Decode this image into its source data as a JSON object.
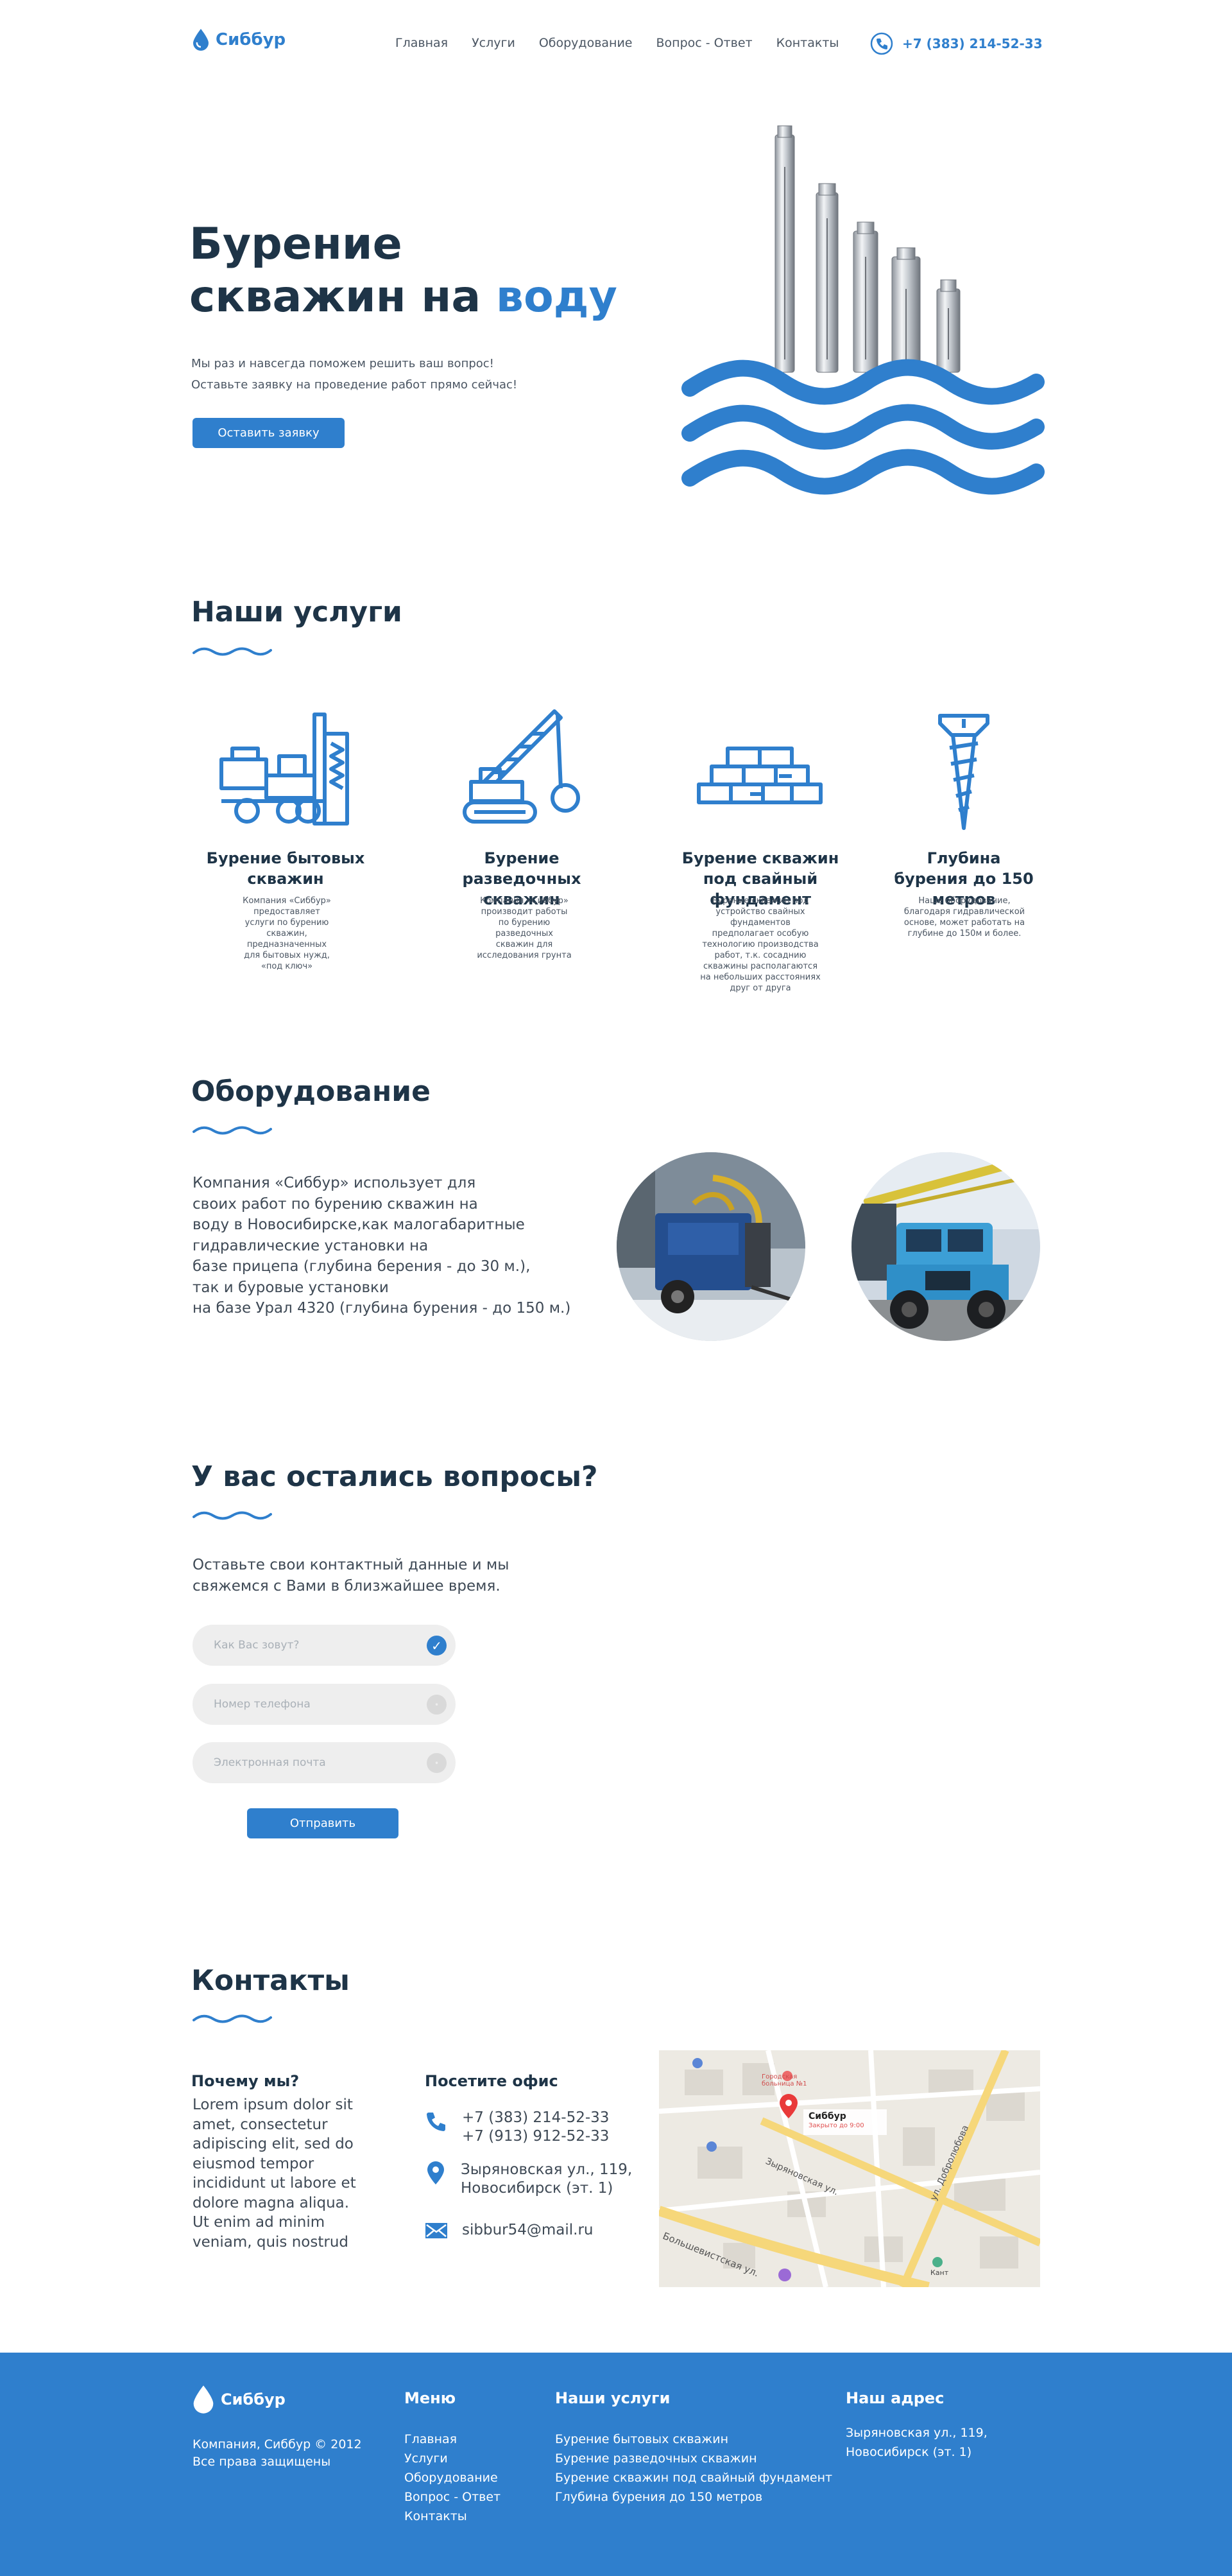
{
  "brand": {
    "name": "Сиббур",
    "color": "#2f7fcd"
  },
  "header": {
    "nav": [
      "Главная",
      "Услуги",
      "Оборудование",
      "Вопрос - Ответ",
      "Контакты"
    ],
    "phone": "+7 (383) 214-52-33",
    "phone_icon": "phone-icon"
  },
  "hero": {
    "title_line1": "Бурение",
    "title_line2_prefix": "скважин на ",
    "title_line2_accent": "воду",
    "subtitle_line1": "Мы раз и навсегда поможем решить ваш вопрос!",
    "subtitle_line2": "Оставьте заявку на проведение работ прямо сейчас!",
    "button": "Оставить заявку"
  },
  "services": {
    "title": "Наши услуги",
    "items": [
      {
        "icon": "drilling-rig-icon",
        "title": "Бурение бытовых скважин",
        "desc": "Компания «Сиббур» предоставляет услуги по бурению скважин, предназначенных для бытовых нужд, «под ключ»"
      },
      {
        "icon": "crane-icon",
        "title": "Бурение разведочных скважин",
        "desc": "Компания «Сиббур» производит работы по бурению разведочных скважин для исследования грунта"
      },
      {
        "icon": "bricks-icon",
        "title": "Бурение скважин под свайный фундамент",
        "desc": "Бурение скважин под устройство свайных фундаментов предполагает особую технологию производства работ, т.к. сосаднию скважины располагаются на небольших расстояниях друг от друга"
      },
      {
        "icon": "screw-icon",
        "title": "Глубина бурения до 150 метров",
        "desc": "Наше оборудование, благодаря гидравлической основе, может работать на глубине до 150м и более."
      }
    ]
  },
  "equipment": {
    "title": "Оборудование",
    "lines": [
      "Компания «Сиббур» использует для",
      "своих работ по бурению скважин на",
      "воду в Новосибирске,как малогабаритные",
      "гидравлические установки на",
      "базе прицепа (глубина берения - до 30 м.),",
      "так и буровые установки",
      "на базе Урал 4320 (глубина бурения - до 150 м.)"
    ]
  },
  "questions": {
    "title": "У вас остались вопросы?",
    "subtitle_line1": "Оставьте свои контактный данные и мы",
    "subtitle_line2": "свяжемся с Вами в близжайшее время.",
    "fields": [
      {
        "placeholder": "Как Вас зовут?",
        "checked": true
      },
      {
        "placeholder": "Номер телефона",
        "checked": false
      },
      {
        "placeholder": "Электронная почта",
        "checked": false
      }
    ],
    "button": "Отправить"
  },
  "contacts": {
    "title": "Контакты",
    "why_title": "Почему мы?",
    "why_text": "Lorem ipsum dolor sit amet, consectetur adipiscing elit, sed do eiusmod tempor incididunt ut labore et dolore magna aliqua. Ut enim ad minim veniam, quis nostrud",
    "visit_title": "Посетите офис",
    "phone1": "+7 (383) 214-52-33",
    "phone2": "+7 (913) 912-52-33",
    "address_line1": "Зыряновская ул., 119,",
    "address_line2": "Новосибирск (эт. 1)",
    "email": "sibbur54@mail.ru",
    "map": {
      "marker_title": "Сиббур",
      "marker_sub": "Закрыто до 9:00",
      "street1": "Большевистская ул.",
      "street2": "Зыряновская ул.",
      "street3": "ул. Добролюбова",
      "poi1": "Городская больница №1",
      "poi2": "Кант"
    }
  },
  "footer": {
    "copyright1": "Компания, Сиббур © 2012",
    "copyright2": "Все права защищены",
    "menu_title": "Меню",
    "menu": [
      "Главная",
      "Услуги",
      "Оборудование",
      "Вопрос - Ответ",
      "Контакты"
    ],
    "services_title": "Наши услуги",
    "services": [
      "Бурение бытовых скважин",
      "Бурение разведочных скважин",
      "Бурение скважин под свайный фундамент",
      "Глубина бурения до 150 метров"
    ],
    "address_title": "Наш адрес",
    "address_line1": "Зыряновская ул., 119,",
    "address_line2": "Новосибирск (эт. 1)"
  }
}
